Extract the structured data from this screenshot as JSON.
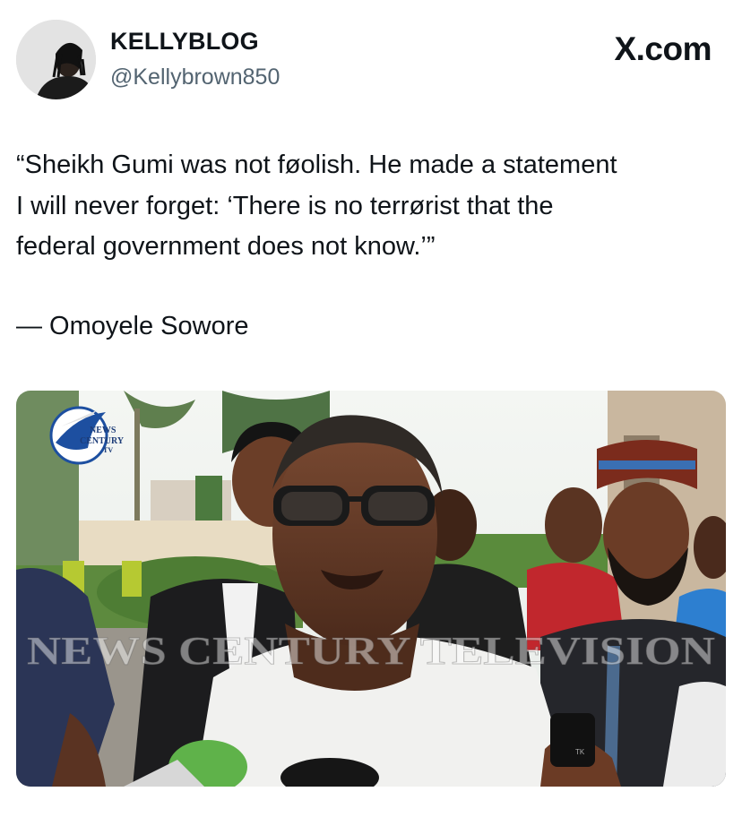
{
  "post": {
    "author": {
      "display_name": "KELLYBLOG",
      "handle": "@Kellybrown850"
    },
    "brand": "X.com",
    "quote_lines": [
      "“Sheikh Gumi was not føolish. He made a statement",
      "I will never forget: ‘There is no terrørist that the",
      "federal government does not know.’”"
    ],
    "attribution": "— Omoyele Sowore"
  },
  "photo": {
    "logo": {
      "line1": "NEWS",
      "line2": "CENTURY",
      "line3": "TV"
    },
    "watermark": "NEWS CENTURY TELEVISION",
    "phone_label": "TK"
  },
  "colors": {
    "text_primary": "#0f1419",
    "text_secondary": "#536471",
    "microphone_green": "#5fb24a"
  }
}
